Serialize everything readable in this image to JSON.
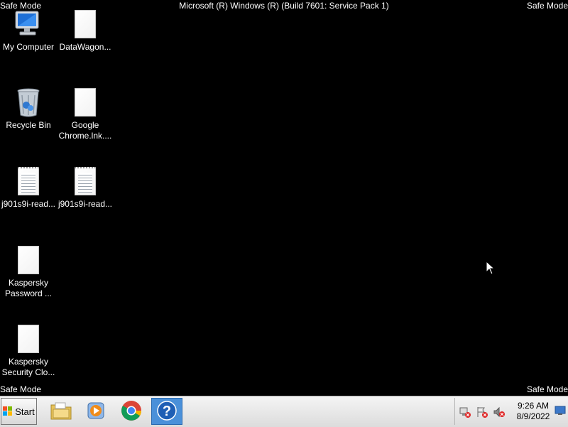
{
  "safe_mode": {
    "tl": "Safe Mode",
    "tr": "Safe Mode",
    "bl": "Safe Mode",
    "br": "Safe Mode"
  },
  "build_text": "Microsoft (R) Windows (R) (Build 7601: Service Pack 1)",
  "desktop_icons": [
    {
      "label": "My Computer",
      "icon": "computer-icon"
    },
    {
      "label": "DataWagon...",
      "icon": "document-icon"
    },
    {
      "label": "Recycle Bin",
      "icon": "recycle-bin-icon"
    },
    {
      "label": "Google Chrome.lnk....",
      "icon": "document-icon"
    },
    {
      "label": "j901s9i-read...",
      "icon": "text-file-icon"
    },
    {
      "label": "j901s9i-read...",
      "icon": "text-file-icon"
    },
    {
      "label": "Kaspersky Password ...",
      "icon": "document-icon"
    },
    {
      "label": "Kaspersky Security Clo...",
      "icon": "document-icon"
    }
  ],
  "taskbar": {
    "start_label": "Start",
    "pinned": [
      "file-explorer-icon",
      "media-player-icon",
      "chrome-icon",
      "help-icon"
    ],
    "clock_time": "9:26 AM",
    "clock_date": "8/9/2022"
  }
}
